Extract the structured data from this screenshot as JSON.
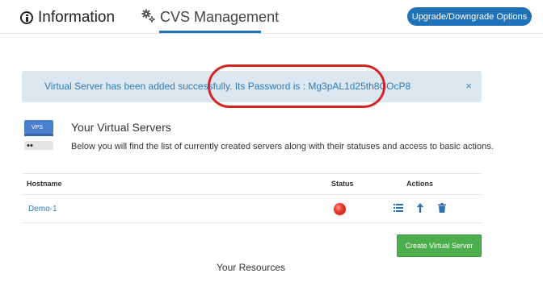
{
  "tabs": [
    {
      "label": "Information",
      "icon": "info-circle-icon"
    },
    {
      "label": "CVS Management",
      "icon": "gears-icon",
      "active": true
    }
  ],
  "upgrade_button": "Upgrade/Downgrade Options",
  "alert": {
    "message": "Virtual Server has been added successfully. Its Password is : Mg3pAL1d25th8COcP8",
    "close": "×"
  },
  "vps_icon_text": "VPS",
  "section": {
    "title": "Your Virtual Servers",
    "description": "Below you will find the list of currently created servers along with their statuses and access to basic actions."
  },
  "table": {
    "headers": {
      "hostname": "Hostname",
      "status": "Status",
      "actions": "Actions"
    },
    "rows": [
      {
        "hostname": "Demo-1",
        "status": "stopped",
        "actions": [
          "list-icon",
          "upload-arrow-icon",
          "trash-icon"
        ]
      }
    ]
  },
  "create_button": "Create Virtual Server",
  "resources_title": "Your Resources",
  "colors": {
    "primary": "#1f72b8",
    "alert_bg": "#dde7f0",
    "alert_text": "#2e7cb8",
    "success": "#4cae4c",
    "status_red": "#e53527",
    "annotation": "#d42424"
  }
}
